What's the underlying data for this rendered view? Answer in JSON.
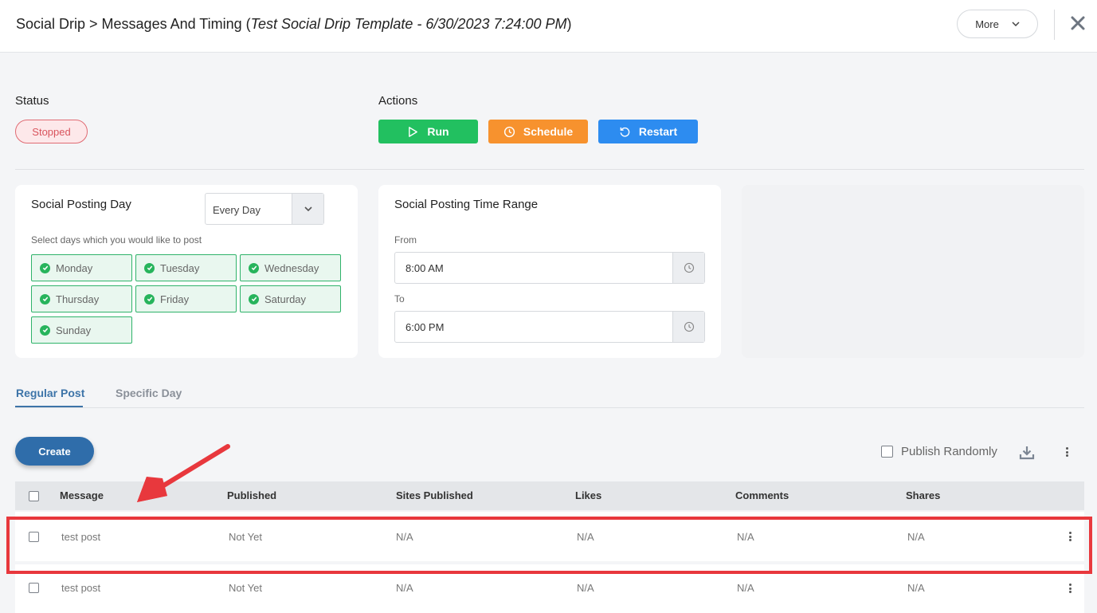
{
  "header": {
    "title_main": "Social Drip > Messages And Timing (",
    "title_italic": "Test Social Drip Template - 6/30/2023 7:24:00 PM",
    "title_end": ")",
    "more_label": "More",
    "close_symbol": "✕"
  },
  "status": {
    "label": "Status",
    "badge": "Stopped",
    "badge_color": "#d9545d"
  },
  "actions": {
    "label": "Actions",
    "run": "Run",
    "schedule": "Schedule",
    "restart": "Restart",
    "run_color": "#22c060",
    "schedule_color": "#f7922e",
    "restart_color": "#2d8cf0"
  },
  "posting_day": {
    "title": "Social Posting Day",
    "select_value": "Every Day",
    "hint": "Select days which you would like to post",
    "days": [
      "Monday",
      "Tuesday",
      "Wednesday",
      "Thursday",
      "Friday",
      "Saturday",
      "Sunday"
    ]
  },
  "time_range": {
    "title": "Social Posting Time Range",
    "from_label": "From",
    "from_value": "8:00 AM",
    "to_label": "To",
    "to_value": "6:00 PM"
  },
  "tabs": {
    "regular": "Regular Post",
    "specific": "Specific Day"
  },
  "toolbar": {
    "create": "Create",
    "publish_randomly": "Publish Randomly"
  },
  "table": {
    "headers": [
      "Message",
      "Published",
      "Sites Published",
      "Likes",
      "Comments",
      "Shares"
    ],
    "rows": [
      [
        "test post",
        "Not Yet",
        "N/A",
        "N/A",
        "N/A",
        "N/A"
      ],
      [
        "test post",
        "Not Yet",
        "N/A",
        "N/A",
        "N/A",
        "N/A"
      ]
    ]
  }
}
